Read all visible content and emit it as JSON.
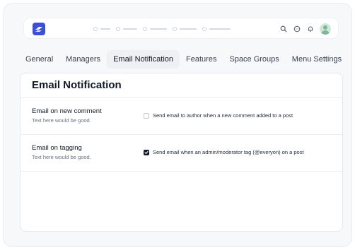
{
  "colors": {
    "brand": "#3b4fd8",
    "tab_active_bg": "#eef0f3",
    "checkbox_checked": "#111827"
  },
  "topbar": {
    "logo_icon": "brand-logo-icon",
    "icons": [
      "search-icon",
      "chat-icon",
      "bell-icon",
      "avatar"
    ]
  },
  "tabs": [
    {
      "label": "General",
      "active": false
    },
    {
      "label": "Managers",
      "active": false
    },
    {
      "label": "Email Notification",
      "active": true
    },
    {
      "label": "Features",
      "active": false
    },
    {
      "label": "Space Groups",
      "active": false
    },
    {
      "label": "Menu Settings",
      "active": false
    }
  ],
  "card": {
    "title": "Email Notification",
    "settings": [
      {
        "title": "Email on new comment",
        "subtitle": "Text here would be good.",
        "option_label": "Send email to author when a new comment added to a post",
        "checked": false
      },
      {
        "title": "Email on tagging",
        "subtitle": "Text here would be good.",
        "option_label": "Send email when an admin/moderator tag (@everyon) on a post",
        "checked": true
      }
    ]
  }
}
